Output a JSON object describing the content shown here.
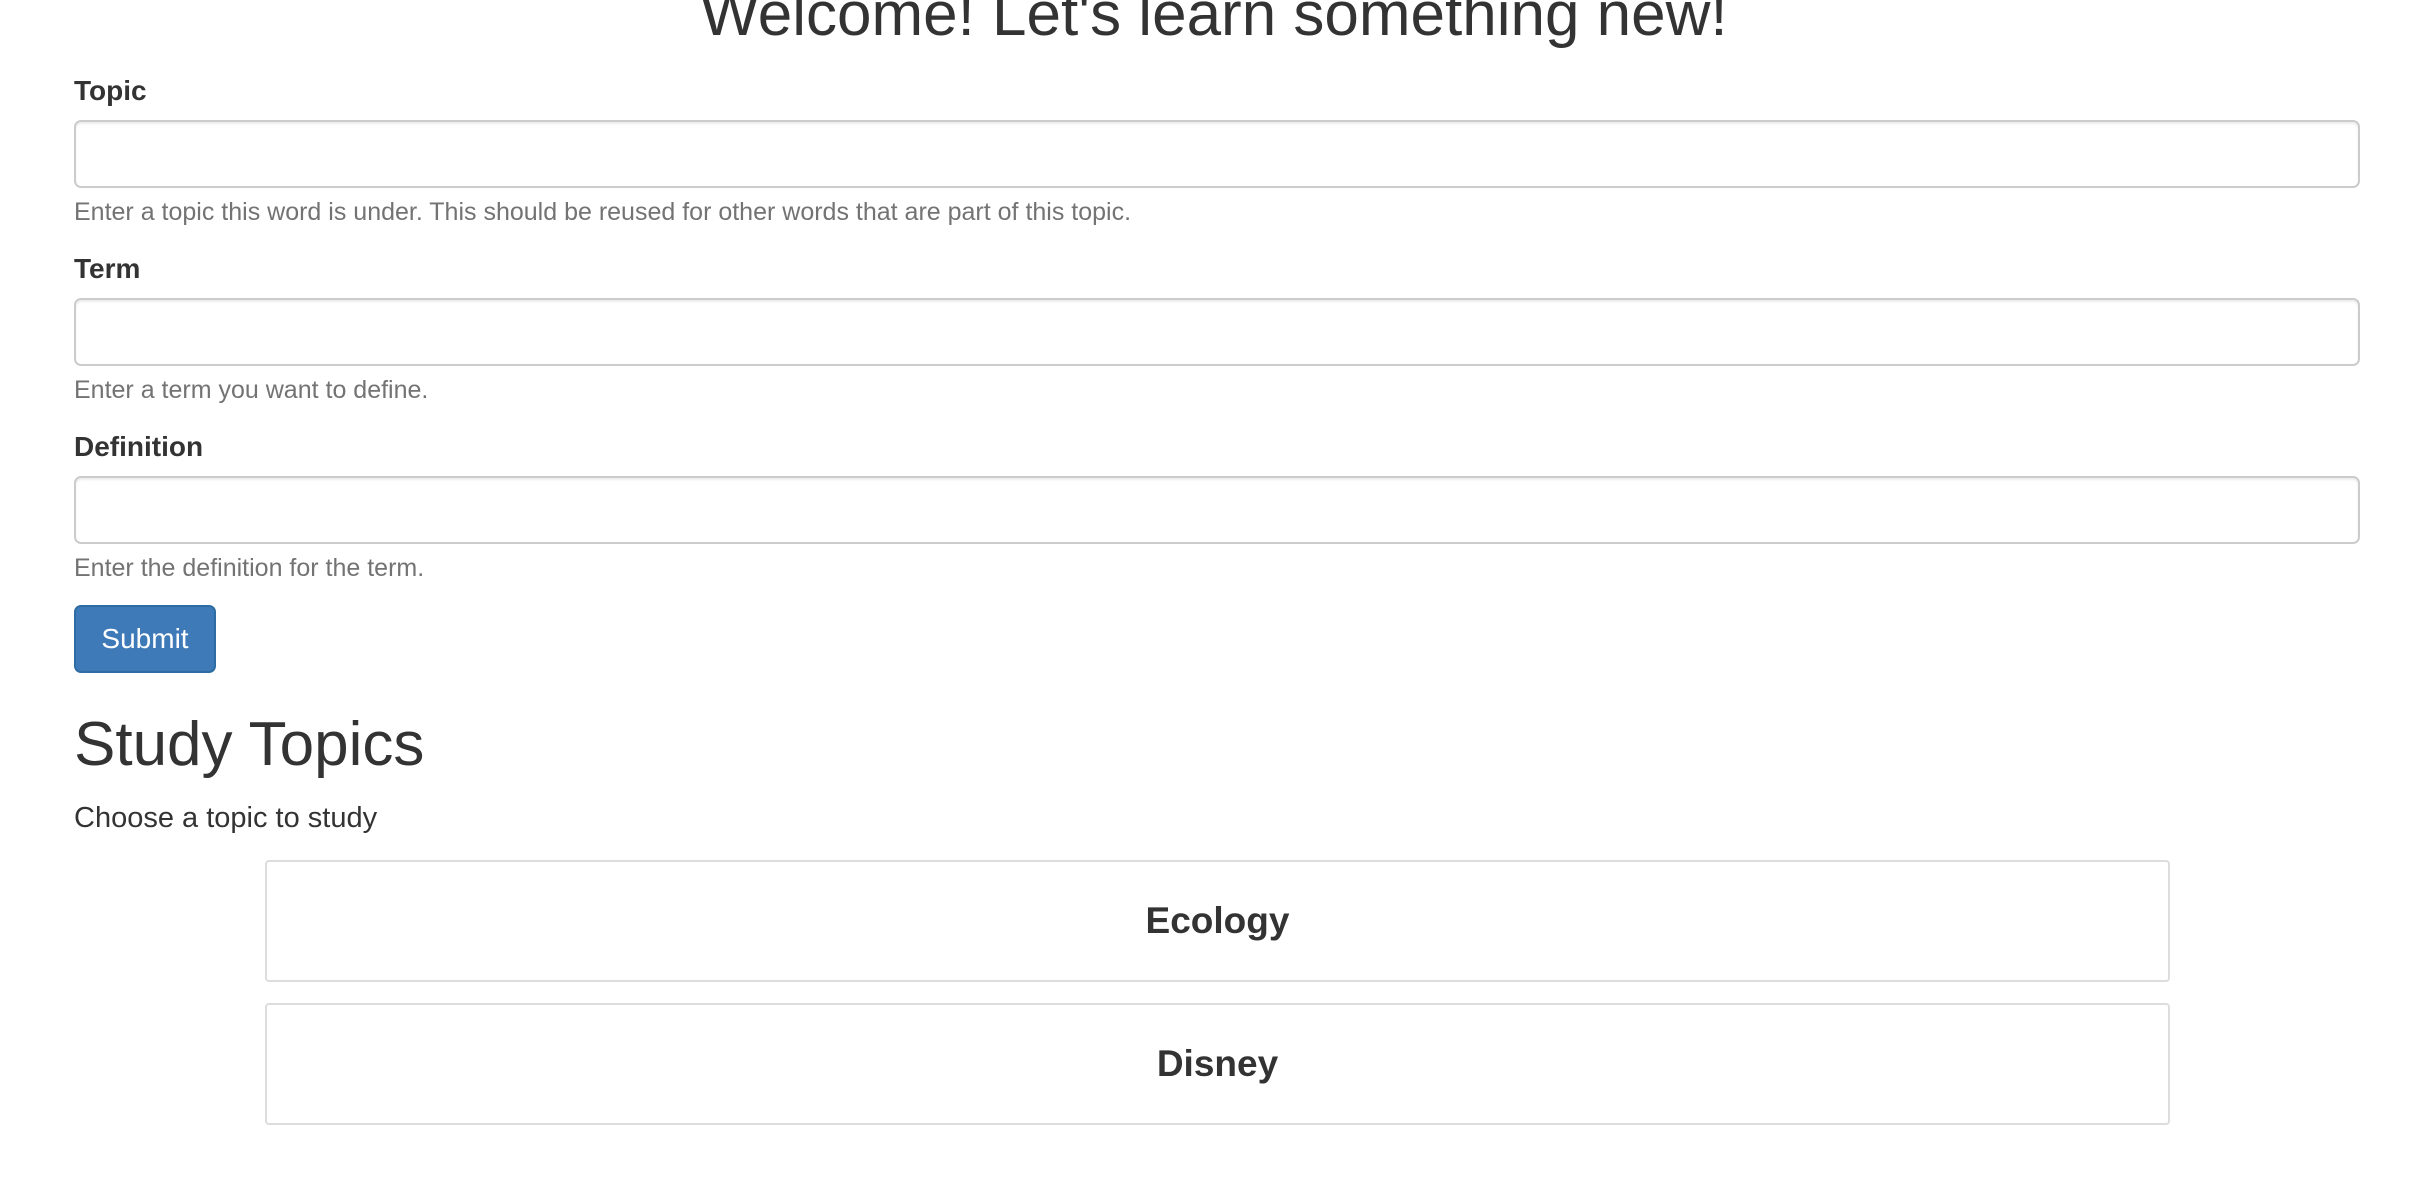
{
  "header": {
    "title": "Welcome! Let's learn something new!"
  },
  "form": {
    "topic": {
      "label": "Topic",
      "value": "",
      "placeholder": "",
      "help": "Enter a topic this word is under. This should be reused for other words that are part of this topic."
    },
    "term": {
      "label": "Term",
      "value": "",
      "placeholder": "",
      "help": "Enter a term you want to define."
    },
    "definition": {
      "label": "Definition",
      "value": "",
      "placeholder": "",
      "help": "Enter the definition for the term."
    },
    "submit_label": "Submit"
  },
  "study": {
    "title": "Study Topics",
    "subtitle": "Choose a topic to study",
    "topics": [
      {
        "label": "Ecology"
      },
      {
        "label": "Disney"
      }
    ]
  },
  "colors": {
    "primary_button": "#3f7ab8",
    "primary_button_border": "#2e6da4",
    "help_text": "#737373",
    "border": "#cccccc"
  }
}
